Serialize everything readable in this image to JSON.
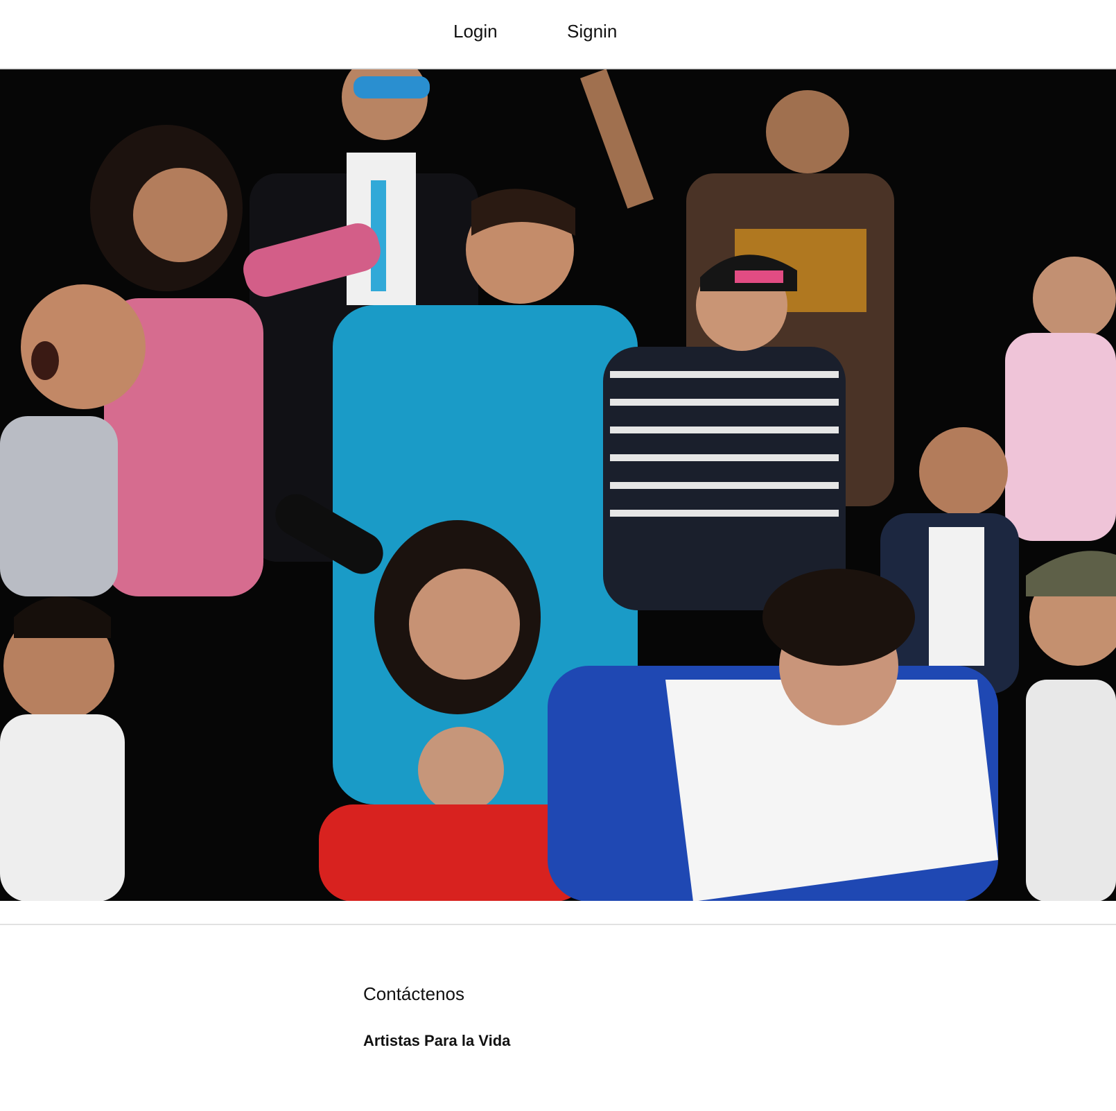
{
  "nav": {
    "login_label": "Login",
    "signin_label": "Signin"
  },
  "hero": {
    "background_color": "#050505"
  },
  "footer": {
    "contact_heading": "Contáctenos",
    "organization_name": "Artistas Para la Vida"
  }
}
